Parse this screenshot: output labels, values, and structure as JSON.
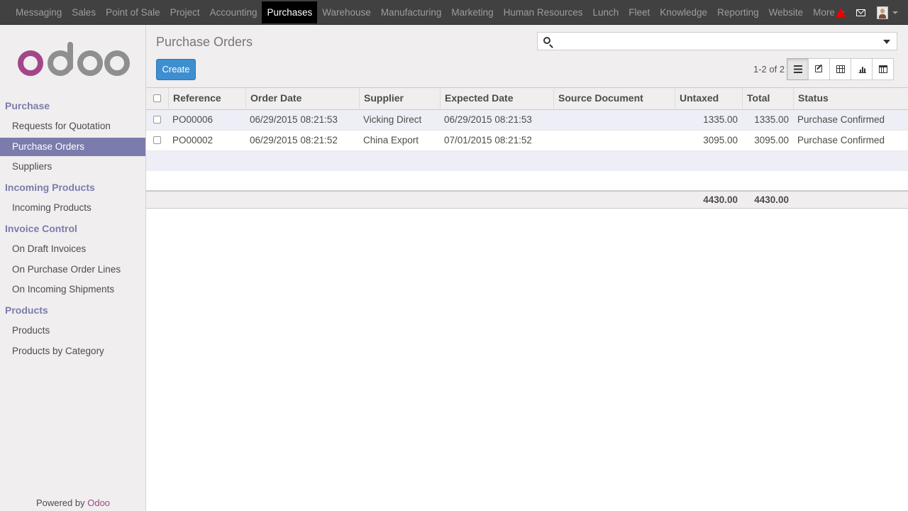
{
  "topbar": {
    "menu": [
      {
        "label": "Messaging",
        "active": false
      },
      {
        "label": "Sales",
        "active": false
      },
      {
        "label": "Point of Sale",
        "active": false
      },
      {
        "label": "Project",
        "active": false
      },
      {
        "label": "Accounting",
        "active": false
      },
      {
        "label": "Purchases",
        "active": true
      },
      {
        "label": "Warehouse",
        "active": false
      },
      {
        "label": "Manufacturing",
        "active": false
      },
      {
        "label": "Marketing",
        "active": false
      },
      {
        "label": "Human Resources",
        "active": false
      },
      {
        "label": "Lunch",
        "active": false
      },
      {
        "label": "Fleet",
        "active": false
      },
      {
        "label": "Knowledge",
        "active": false
      },
      {
        "label": "Reporting",
        "active": false
      },
      {
        "label": "Website",
        "active": false
      }
    ],
    "more_label": "More",
    "icons": [
      "warning-icon",
      "mail-icon",
      "user-avatar"
    ]
  },
  "sidebar": {
    "logo_text": "odoo",
    "sections": [
      {
        "title": "Purchase",
        "items": [
          {
            "label": "Requests for Quotation",
            "active": false
          },
          {
            "label": "Purchase Orders",
            "active": true
          },
          {
            "label": "Suppliers",
            "active": false
          }
        ]
      },
      {
        "title": "Incoming Products",
        "items": [
          {
            "label": "Incoming Products",
            "active": false
          }
        ]
      },
      {
        "title": "Invoice Control",
        "items": [
          {
            "label": "On Draft Invoices",
            "active": false
          },
          {
            "label": "On Purchase Order Lines",
            "active": false
          },
          {
            "label": "On Incoming Shipments",
            "active": false
          }
        ]
      },
      {
        "title": "Products",
        "items": [
          {
            "label": "Products",
            "active": false
          },
          {
            "label": "Products by Category",
            "active": false
          }
        ]
      }
    ],
    "powered_prefix": "Powered by",
    "powered_brand": "Odoo"
  },
  "control_panel": {
    "title": "Purchase Orders",
    "search_placeholder": "",
    "create_label": "Create",
    "pager": "1-2 of 2",
    "views": [
      "list",
      "form",
      "pivot",
      "graph",
      "calendar"
    ],
    "active_view": "list"
  },
  "table": {
    "columns": [
      "Reference",
      "Order Date",
      "Supplier",
      "Expected Date",
      "Source Document",
      "Untaxed",
      "Total",
      "Status"
    ],
    "rows": [
      [
        "PO00006",
        "06/29/2015 08:21:53",
        "Vicking Direct",
        "06/29/2015 08:21:53",
        "",
        "1335.00",
        "1335.00",
        "Purchase Confirmed"
      ],
      [
        "PO00002",
        "06/29/2015 08:21:52",
        "China Export",
        "07/01/2015 08:21:52",
        "",
        "3095.00",
        "3095.00",
        "Purchase Confirmed"
      ]
    ],
    "totals": {
      "untaxed": "4430.00",
      "total": "4430.00"
    }
  },
  "colors": {
    "topbar": "#414141",
    "accent": "#7c7bad",
    "create_button": "#3d8fd0",
    "brand": "#a24689"
  }
}
